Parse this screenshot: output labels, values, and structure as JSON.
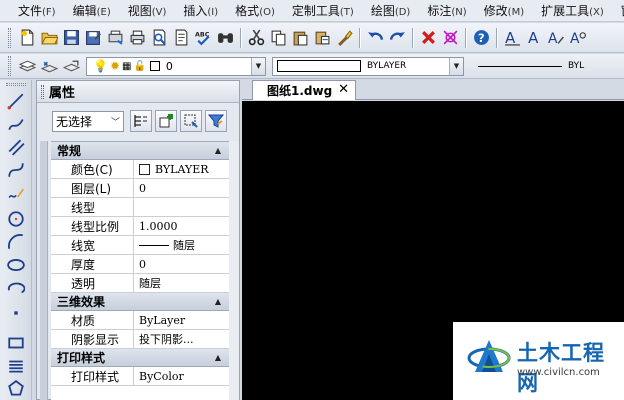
{
  "menu": [
    {
      "label": "文件",
      "key": "(F)"
    },
    {
      "label": "编辑",
      "key": "(E)"
    },
    {
      "label": "视图",
      "key": "(V)"
    },
    {
      "label": "插入",
      "key": "(I)"
    },
    {
      "label": "格式",
      "key": "(O)"
    },
    {
      "label": "定制工具",
      "key": "(T)"
    },
    {
      "label": "绘图",
      "key": "(D)"
    },
    {
      "label": "标注",
      "key": "(N)"
    },
    {
      "label": "修改",
      "key": "(M)"
    },
    {
      "label": "扩展工具",
      "key": "(X)"
    },
    {
      "label": "窗",
      "key": ""
    }
  ],
  "layer_bar": {
    "current_layer": "0",
    "linetype": "BYLAYER",
    "lineweight": "BYL"
  },
  "properties": {
    "title": "属性",
    "selection": "无选择",
    "sections": [
      {
        "title": "常规",
        "rows": [
          {
            "name": "颜色(C)",
            "value": "BYLAYER"
          },
          {
            "name": "图层(L)",
            "value": "0"
          },
          {
            "name": "线型",
            "value": ""
          },
          {
            "name": "线型比例",
            "value": "1.0000"
          },
          {
            "name": "线宽",
            "value": "随层"
          },
          {
            "name": "厚度",
            "value": "0"
          },
          {
            "name": "透明",
            "value": "随层"
          }
        ]
      },
      {
        "title": "三维效果",
        "rows": [
          {
            "name": "材质",
            "value": "ByLayer"
          },
          {
            "name": "阴影显示",
            "value": "投下阴影..."
          }
        ]
      },
      {
        "title": "打印样式",
        "rows": [
          {
            "name": "打印样式",
            "value": "ByColor"
          }
        ]
      }
    ]
  },
  "document": {
    "tab_label": "图纸1.dwg",
    "close_glyph": "✕"
  },
  "watermark": {
    "name": "土木工程网",
    "url": "www.civilcn.com"
  },
  "colors": {
    "canvas": "#000000",
    "brand_blue": "#1565b0"
  }
}
